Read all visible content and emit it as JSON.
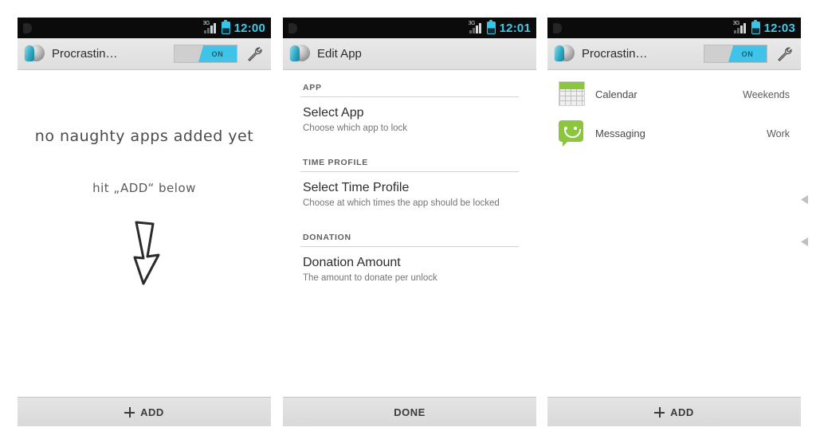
{
  "panels": [
    {
      "name": "home-empty",
      "statusbar": {
        "time": "12:00",
        "network": "3G",
        "notification_icon": "notification-icon",
        "signal_icon": "signal-icon",
        "battery_icon": "battery-icon"
      },
      "actionbar": {
        "title": "Procrastin…",
        "toggle_label": "ON",
        "toggle_state": "on",
        "settings_icon": "wrench-icon",
        "app_icon": "app-logo-icon"
      },
      "empty_state": {
        "line1": "no naughty apps added yet",
        "line2": "hit „ADD“ below",
        "arrow_icon": "down-arrow-icon"
      },
      "bottombar": {
        "label": "ADD",
        "icon": "plus-icon"
      }
    },
    {
      "name": "edit-app",
      "statusbar": {
        "time": "12:01",
        "network": "3G",
        "notification_icon": "notification-icon",
        "signal_icon": "signal-icon",
        "battery_icon": "battery-icon"
      },
      "actionbar": {
        "title": "Edit App",
        "app_icon": "app-logo-icon"
      },
      "sections": [
        {
          "header": "APP",
          "items": [
            {
              "title": "Select App",
              "subtitle": "Choose which app to lock"
            }
          ]
        },
        {
          "header": "TIME PROFILE",
          "items": [
            {
              "title": "Select Time Profile",
              "subtitle": "Choose at which times the app should be locked"
            }
          ]
        },
        {
          "header": "DONATION",
          "items": [
            {
              "title": "Donation Amount",
              "subtitle": "The amount to donate per unlock"
            }
          ]
        }
      ],
      "bottombar": {
        "label": "DONE"
      }
    },
    {
      "name": "home-with-apps",
      "statusbar": {
        "time": "12:03",
        "network": "3G",
        "notification_icon": "notification-icon",
        "signal_icon": "signal-icon",
        "battery_icon": "battery-icon"
      },
      "actionbar": {
        "title": "Procrastin…",
        "toggle_label": "ON",
        "toggle_state": "on",
        "settings_icon": "wrench-icon",
        "app_icon": "app-logo-icon"
      },
      "apps": [
        {
          "name": "Calendar",
          "profile": "Weekends",
          "icon": "calendar-icon"
        },
        {
          "name": "Messaging",
          "profile": "Work",
          "icon": "messaging-icon"
        }
      ],
      "bottombar": {
        "label": "ADD",
        "icon": "plus-icon"
      }
    }
  ],
  "colors": {
    "accent": "#3fc3e8",
    "statusbar_bg": "#0b0b0b",
    "statusbar_text": "#3fc9ea",
    "actionbar_bg": "#e4e4e4",
    "app_icon_green": "#8cc63e"
  },
  "edge_markers": {
    "top_icon": "chevron-left-icon",
    "bottom_icon": "chevron-left-icon"
  }
}
